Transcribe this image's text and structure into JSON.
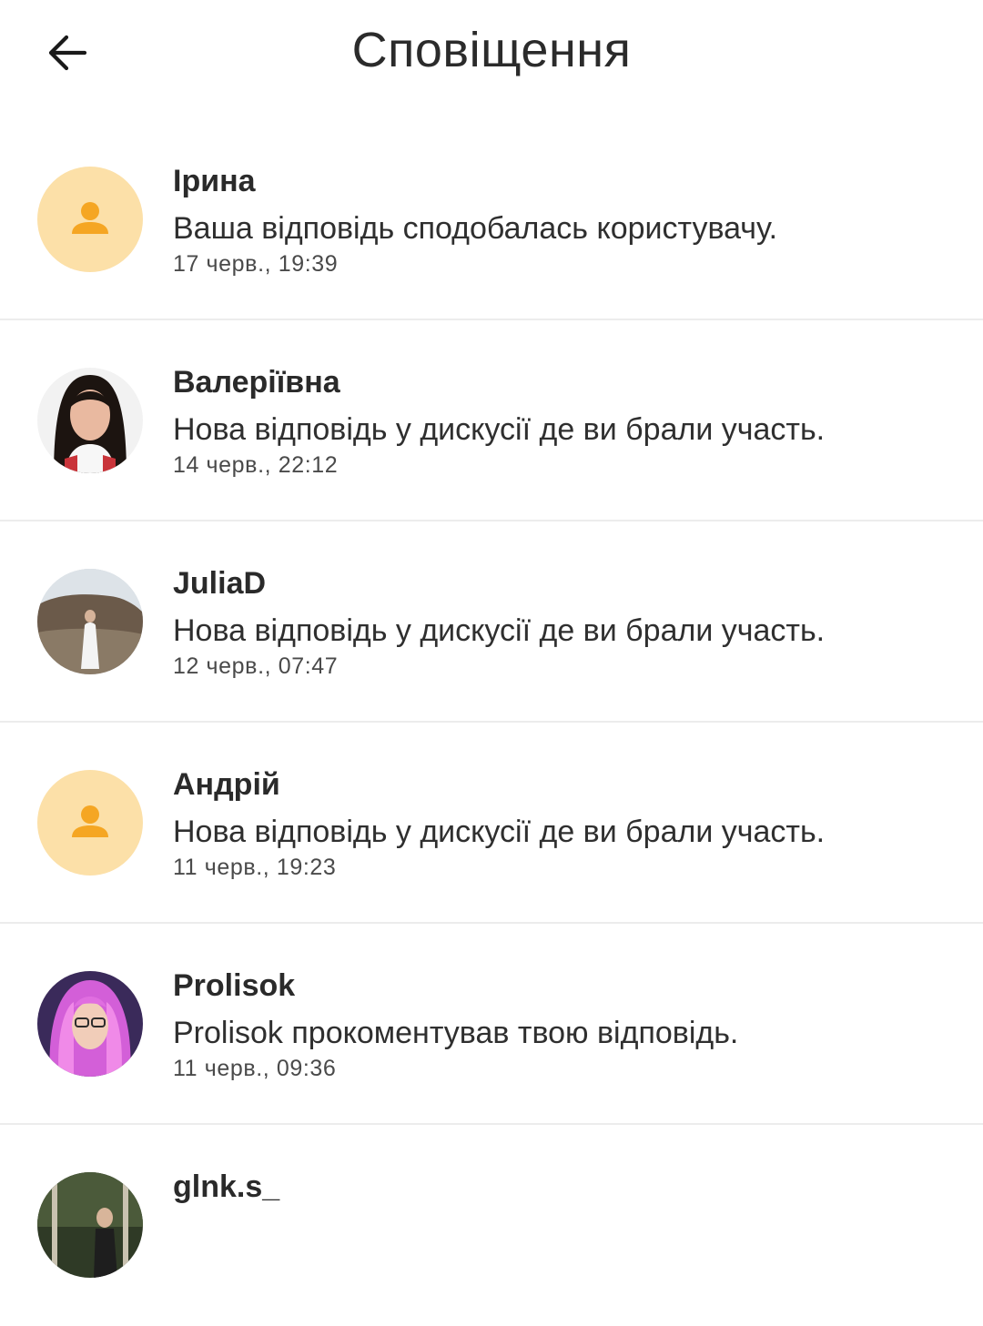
{
  "header": {
    "title": "Сповіщення",
    "back_icon": "arrow-left-icon"
  },
  "colors": {
    "placeholder_avatar_bg": "#fce0a8",
    "placeholder_avatar_icon": "#f5a623",
    "divider": "#ececec"
  },
  "notifications": [
    {
      "name": "Ірина",
      "message": "Ваша відповідь сподобалась користувачу.",
      "time": "17 черв., 19:39",
      "avatar": "person-placeholder-icon"
    },
    {
      "name": "Валеріївна",
      "message": "Нова відповідь у дискусії де ви брали участь.",
      "time": "14 черв., 22:12",
      "avatar": "user-photo"
    },
    {
      "name": "JuliaD",
      "message": "Нова відповідь у дискусії де ви брали участь.",
      "time": "12 черв., 07:47",
      "avatar": "user-photo"
    },
    {
      "name": "Андрій",
      "message": "Нова відповідь у дискусії де ви брали участь.",
      "time": "11 черв., 19:23",
      "avatar": "person-placeholder-icon"
    },
    {
      "name": "Prolisok",
      "message": "Prolisok прокоментував твою відповідь.",
      "time": "11 черв., 09:36",
      "avatar": "user-photo"
    },
    {
      "name": "glnk.s_",
      "message": "",
      "time": "",
      "avatar": "user-photo"
    }
  ]
}
